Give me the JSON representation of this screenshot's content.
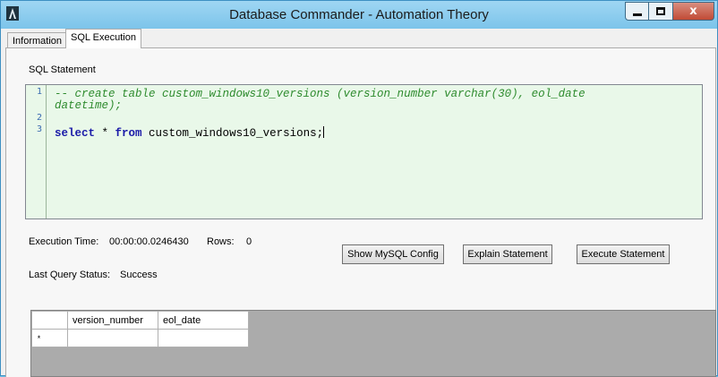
{
  "window": {
    "title": "Database Commander - Automation Theory",
    "close_glyph": "x",
    "accent_color": "#7cc4ea",
    "close_color": "#c14a35"
  },
  "tabs": [
    {
      "label": "Information",
      "selected": false
    },
    {
      "label": "SQL Execution",
      "selected": true
    }
  ],
  "sql": {
    "label": "SQL Statement",
    "line_numbers": [
      "1",
      "2",
      "3"
    ],
    "line1a": "-- create table custom_windows10_versions (version_number varchar(30), eol_date",
    "line1b": "datetime);",
    "line3_kw1": "select",
    "line3_mid": " * ",
    "line3_kw2": "from",
    "line3_rest": " custom_windows10_versions;"
  },
  "status": {
    "exec_time_label": "Execution Time:",
    "exec_time_value": "00:00:00.0246430",
    "rows_label": "Rows:",
    "rows_value": "0",
    "last_status_label": "Last Query Status:",
    "last_status_value": "Success"
  },
  "buttons": {
    "show_config": "Show MySQL Config",
    "explain": "Explain Statement",
    "execute": "Execute Statement"
  },
  "grid": {
    "columns": [
      "version_number",
      "eol_date"
    ],
    "new_row_marker": "*"
  },
  "icons": {
    "app": "app-logo-icon",
    "minimize": "minimize-icon",
    "maximize": "maximize-icon",
    "close": "close-icon"
  }
}
